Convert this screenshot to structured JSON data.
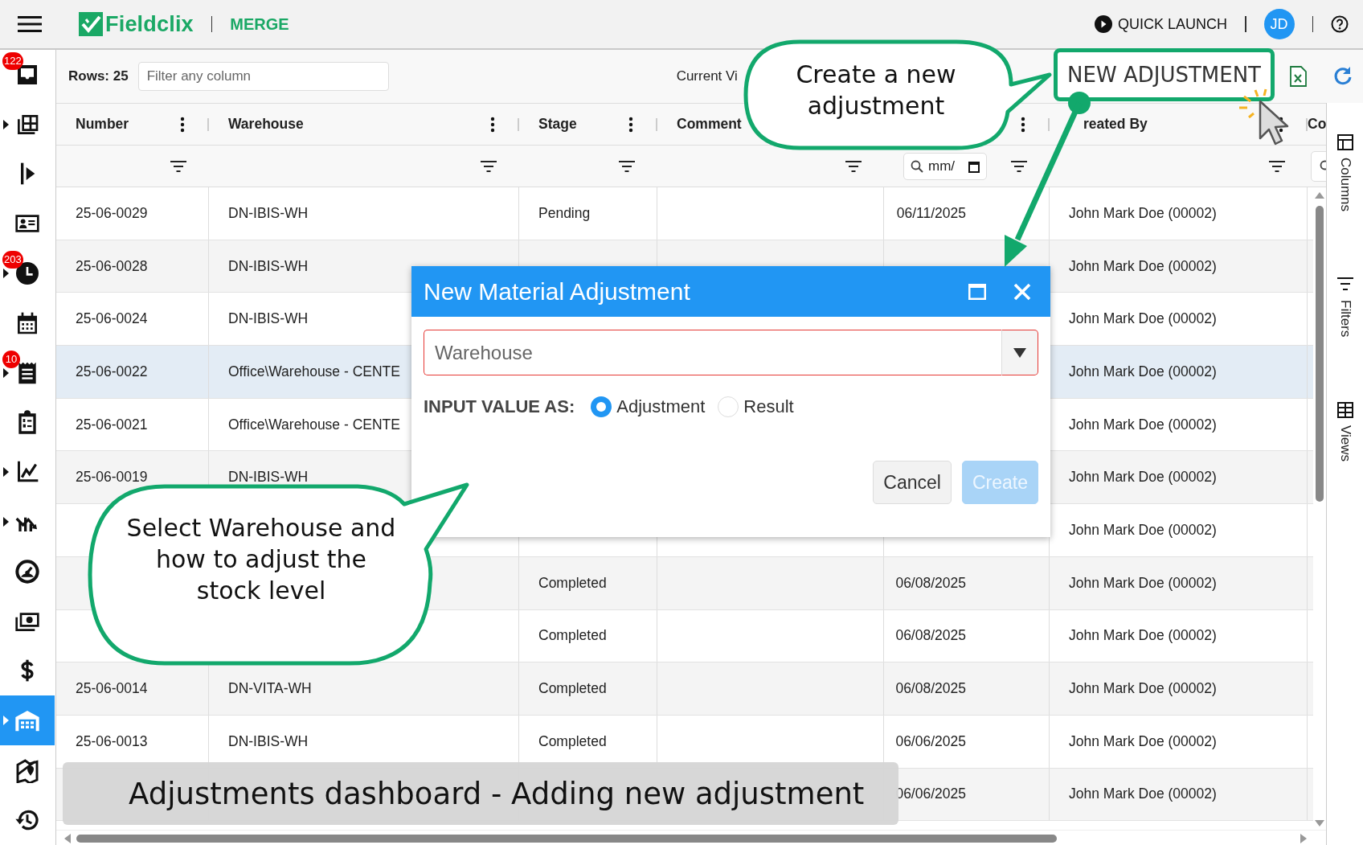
{
  "topbar": {
    "app_name": "Fieldclix",
    "module": "MERGE",
    "quick_launch": "QUICK LAUNCH",
    "avatar": "JD"
  },
  "sidebar": {
    "items": [
      {
        "kind": "inbox",
        "badge": "122",
        "expandable": false,
        "selected": false
      },
      {
        "kind": "grid",
        "expandable": true,
        "selected": false
      },
      {
        "kind": "marker",
        "expandable": false,
        "selected": false
      },
      {
        "kind": "contact",
        "expandable": false,
        "selected": false
      },
      {
        "kind": "clock",
        "badge": "203",
        "expandable": true,
        "selected": false
      },
      {
        "kind": "calendar",
        "expandable": false,
        "selected": false
      },
      {
        "kind": "receipt",
        "badge": "10",
        "expandable": true,
        "selected": false
      },
      {
        "kind": "clipboard",
        "expandable": false,
        "selected": false
      },
      {
        "kind": "chart",
        "expandable": true,
        "selected": false
      },
      {
        "kind": "trend",
        "expandable": true,
        "selected": false
      },
      {
        "kind": "gauge",
        "expandable": false,
        "selected": false
      },
      {
        "kind": "money",
        "expandable": false,
        "selected": false
      },
      {
        "kind": "dollar",
        "expandable": false,
        "selected": false
      },
      {
        "kind": "warehouse",
        "expandable": true,
        "selected": true
      },
      {
        "kind": "map",
        "expandable": false,
        "selected": false
      },
      {
        "kind": "history",
        "expandable": false,
        "selected": false
      }
    ]
  },
  "toolbar": {
    "rows": "Rows: 25",
    "filter_placeholder": "Filter any column",
    "current_view": "Current Vi",
    "new_button": "NEW ADJUSTMENT"
  },
  "table": {
    "columns": [
      {
        "label": "Number",
        "kind": "icon",
        "menu": true
      },
      {
        "label": "Warehouse",
        "kind": "icon",
        "menu": true
      },
      {
        "label": "Stage",
        "kind": "icon",
        "menu": true
      },
      {
        "label": "Comment",
        "kind": "icon",
        "menu": false
      },
      {
        "kind": "date",
        "placeholder": "mm/",
        "menu": true
      },
      {
        "label": "reated By",
        "kind": "icon",
        "menu": true
      },
      {
        "label": "Co",
        "kind": "search",
        "menu": false
      }
    ],
    "rows": [
      {
        "number": "25-06-0029",
        "warehouse": "DN-IBIS-WH",
        "stage": "Pending",
        "date": "06/11/2025",
        "created_by": "John Mark Doe (00002)",
        "selected": false
      },
      {
        "number": "25-06-0028",
        "warehouse": "DN-IBIS-WH",
        "created_by": "John Mark Doe (00002)",
        "selected": false
      },
      {
        "number": "25-06-0024",
        "warehouse": "DN-IBIS-WH",
        "created_by": "John Mark Doe (00002)",
        "selected": false
      },
      {
        "number": "25-06-0022",
        "warehouse": "Office\\Warehouse - CENTE",
        "created_by": "John Mark Doe (00002)",
        "selected": true
      },
      {
        "number": "25-06-0021",
        "warehouse": "Office\\Warehouse - CENTE",
        "created_by": "John Mark Doe (00002)",
        "selected": false
      },
      {
        "number": "25-06-0019",
        "warehouse": "DN-IBIS-WH",
        "created_by": "John Mark Doe (00002)",
        "selected": false
      },
      {
        "created_by": "John Mark Doe (00002)",
        "selected": false
      },
      {
        "stage": "Completed",
        "date": "06/08/2025",
        "created_by": "John Mark Doe (00002)",
        "selected": false
      },
      {
        "stage": "Completed",
        "date": "06/08/2025",
        "created_by": "John Mark Doe (00002)",
        "selected": false
      },
      {
        "number": "25-06-0014",
        "warehouse": "DN-VITA-WH",
        "stage": "Completed",
        "date": "06/08/2025",
        "created_by": "John Mark Doe (00002)",
        "selected": false
      },
      {
        "number": "25-06-0013",
        "warehouse": "DN-IBIS-WH",
        "stage": "Completed",
        "date": "06/06/2025",
        "created_by": "John Mark Doe (00002)",
        "selected": false
      },
      {
        "date": "06/06/2025",
        "created_by": "John Mark Doe (00002)",
        "selected": false
      }
    ]
  },
  "side_panel": [
    {
      "kind": "columns",
      "label": "Columns"
    },
    {
      "kind": "filters",
      "label": "Filters"
    },
    {
      "kind": "views",
      "label": "Views"
    }
  ],
  "dialog": {
    "title": "New Material Adjustment",
    "warehouse_placeholder": "Warehouse",
    "invalid": true,
    "input_label": "INPUT VALUE AS:",
    "options": [
      {
        "label": "Adjustment",
        "selected": true
      },
      {
        "label": "Result",
        "selected": false
      }
    ],
    "buttons": [
      {
        "label": "Cancel",
        "kind": "secondary"
      },
      {
        "label": "Create",
        "kind": "primary",
        "disabled": true
      }
    ]
  },
  "callouts": [
    {
      "kind": "right",
      "text": "Create a new adjustment"
    },
    {
      "kind": "up",
      "text": "Select Warehouse and how to adjust the stock level"
    }
  ],
  "caption": "Adjustments dashboard - Adding new adjustment"
}
